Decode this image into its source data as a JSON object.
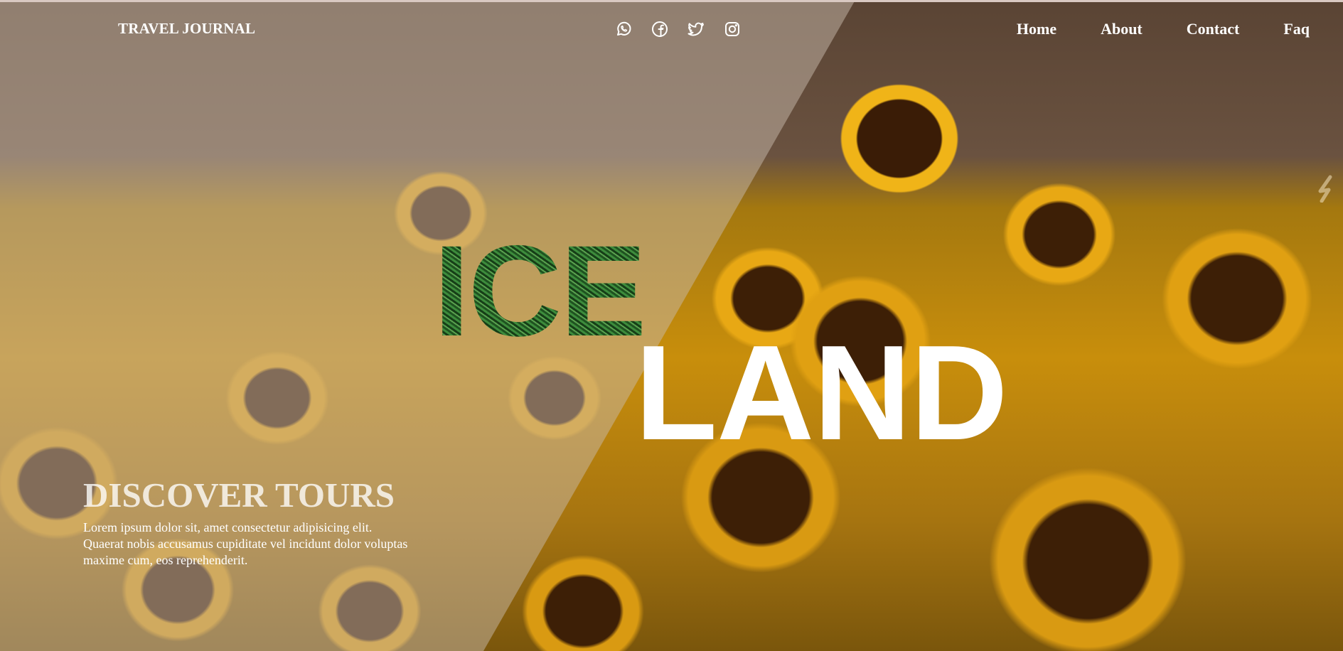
{
  "header": {
    "brand": "TRAVEL JOURNAL",
    "socials": [
      {
        "icon": "whatsapp-icon"
      },
      {
        "icon": "facebook-icon"
      },
      {
        "icon": "twitter-icon"
      },
      {
        "icon": "instagram-icon"
      }
    ],
    "nav": [
      {
        "label": "Home"
      },
      {
        "label": "About"
      },
      {
        "label": "Contact"
      },
      {
        "label": "Faq"
      }
    ]
  },
  "hero": {
    "word_top": "ICE",
    "word_bottom": "LAND",
    "background": "sunflower-field-photo"
  },
  "discover": {
    "title": "DISCOVER TOURS",
    "text": "Lorem ipsum dolor sit, amet consectetur adipisicing elit. Quaerat nobis accusamus cupiditate vel incidunt dolor voluptas maxime cum, eos reprehenderit."
  },
  "colors": {
    "text": "#ffffff",
    "overlay": "#c8baac",
    "sunflower": "#e8a814",
    "grass": "#2c6a2e"
  }
}
